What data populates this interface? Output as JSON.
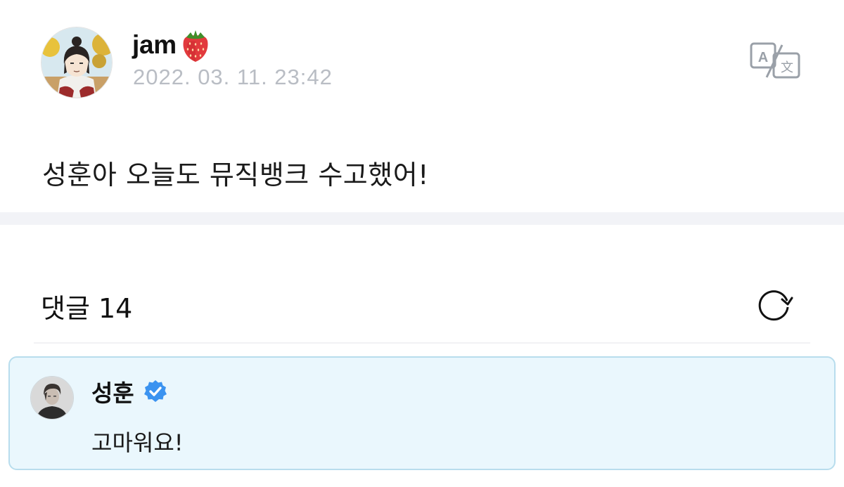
{
  "post": {
    "author": "jam",
    "author_emoji": "strawberry-icon",
    "timestamp": "2022. 03. 11. 23:42",
    "text": "성훈아 오늘도 뮤직뱅크 수고했어!",
    "translate_icon": "translate-icon"
  },
  "comments": {
    "title": "댓글 14",
    "refresh_icon": "refresh-icon",
    "items": [
      {
        "author": "성훈",
        "verified": true,
        "text": "고마워요!"
      }
    ]
  },
  "colors": {
    "timestamp": "#b9bdc4",
    "divider": "#f2f3f7",
    "comment_bg": "#eaf7fd",
    "comment_border": "#b8dded",
    "verified_badge": "#3b93f0"
  }
}
